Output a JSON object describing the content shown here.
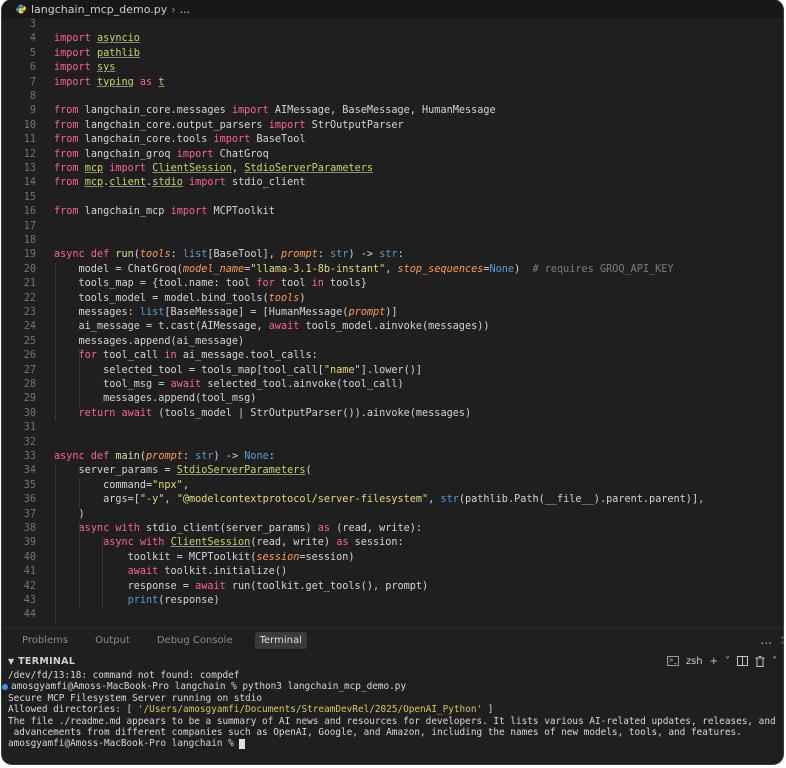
{
  "breadcrumb": {
    "file": "langchain_mcp_demo.py",
    "more": "..."
  },
  "icons": {
    "file": "python-file-icon",
    "more": "ellipsis-icon"
  },
  "editor": {
    "line_numbers": [
      "3",
      "4",
      "5",
      "6",
      "7",
      "8",
      "9",
      "10",
      "11",
      "12",
      "13",
      "14",
      "15",
      "16",
      "17",
      "18",
      "19",
      "20",
      "21",
      "22",
      "23",
      "24",
      "25",
      "26",
      "27",
      "28",
      "29",
      "30",
      "31",
      "32",
      "33",
      "34",
      "35",
      "36",
      "37",
      "38",
      "39",
      "40",
      "41",
      "42",
      "43",
      "44"
    ],
    "code": [
      "",
      "import asyncio",
      "import pathlib",
      "import sys",
      "import typing as t",
      "",
      "from langchain_core.messages import AIMessage, BaseMessage, HumanMessage",
      "from langchain_core.output_parsers import StrOutputParser",
      "from langchain_core.tools import BaseTool",
      "from langchain_groq import ChatGroq",
      "from mcp import ClientSession, StdioServerParameters",
      "from mcp.client.stdio import stdio_client",
      "",
      "from langchain_mcp import MCPToolkit",
      "",
      "",
      "async def run(tools: list[BaseTool], prompt: str) -> str:",
      "    model = ChatGroq(model_name=\"llama-3.1-8b-instant\", stop_sequences=None)  # requires GROQ_API_KEY",
      "    tools_map = {tool.name: tool for tool in tools}",
      "    tools_model = model.bind_tools(tools)",
      "    messages: list[BaseMessage] = [HumanMessage(prompt)]",
      "    ai_message = t.cast(AIMessage, await tools_model.ainvoke(messages))",
      "    messages.append(ai_message)",
      "    for tool_call in ai_message.tool_calls:",
      "        selected_tool = tools_map[tool_call[\"name\"].lower()]",
      "        tool_msg = await selected_tool.ainvoke(tool_call)",
      "        messages.append(tool_msg)",
      "    return await (tools_model | StrOutputParser()).ainvoke(messages)",
      "",
      "",
      "async def main(prompt: str) -> None:",
      "    server_params = StdioServerParameters(",
      "        command=\"npx\",",
      "        args=[\"-y\", \"@modelcontextprotocol/server-filesystem\", str(pathlib.Path(__file__).parent.parent)],",
      "    )",
      "    async with stdio_client(server_params) as (read, write):",
      "        async with ClientSession(read, write) as session:",
      "            toolkit = MCPToolkit(session=session)",
      "            await toolkit.initialize()",
      "            response = await run(toolkit.get_tools(), prompt)",
      "            print(response)",
      ""
    ]
  },
  "panel": {
    "tabs": [
      "Problems",
      "Output",
      "Debug Console",
      "Terminal"
    ],
    "active_tab": "Terminal",
    "more": "...",
    "close": "×"
  },
  "terminal_header": {
    "title": "TERMINAL",
    "shell": "zsh",
    "add": "+",
    "split_chevron": "˅",
    "chevron": "˅",
    "icons": [
      "terminal-shell-icon",
      "add-terminal-icon",
      "split-terminal-icon",
      "trash-icon"
    ]
  },
  "terminal": {
    "lines": [
      "/dev/fd/13:18: command not found: compdef",
      "amosgyamfi@Amoss-MacBook-Pro langchain % python3 langchain_mcp_demo.py",
      "Secure MCP Filesystem Server running on stdio",
      "Allowed directories: [ '/Users/amosgyamfi/Documents/StreamDevRel/2025/OpenAI_Python' ]",
      "The file ./readme.md appears to be a summary of AI news and resources for developers. It lists various AI-related updates, releases, and",
      " advancements from different companies such as OpenAI, Google, and Amazon, including the names of new models, tools, and features.",
      "amosgyamfi@Amoss-MacBook-Pro langchain % "
    ]
  },
  "colors": {
    "background": "#1f1f1f",
    "keyword": "#ff5fa2",
    "string": "#e6db74",
    "function": "#dcdcaa",
    "parameter": "#ff9a52",
    "comment": "#7c7c7c",
    "accent": "#3794ff"
  }
}
